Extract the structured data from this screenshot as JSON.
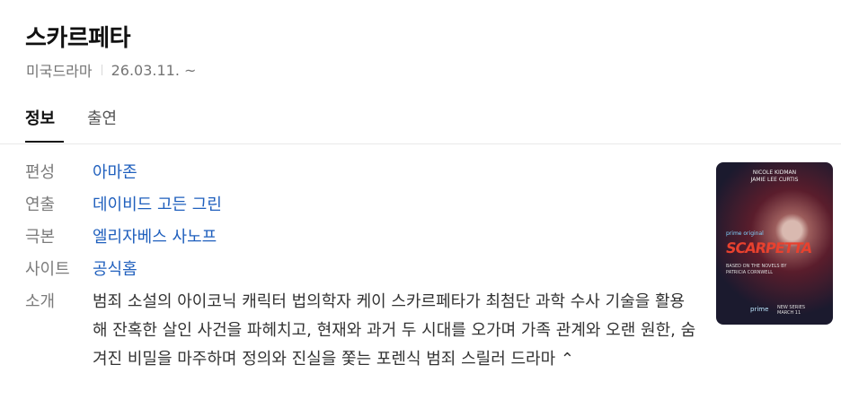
{
  "header": {
    "title": "스카르페타",
    "genre": "미국드라마",
    "date": "26.03.11. ~"
  },
  "tabs": [
    {
      "label": "정보",
      "active": true
    },
    {
      "label": "출연",
      "active": false
    }
  ],
  "info": {
    "rows": [
      {
        "label": "편성",
        "value": "아마존"
      },
      {
        "label": "연출",
        "value": "데이비드 고든 그린"
      },
      {
        "label": "극본",
        "value": "엘리자베스 사노프"
      },
      {
        "label": "사이트",
        "value": "공식홈"
      }
    ],
    "synopsis_label": "소개",
    "synopsis": "범죄 소설의 아이코닉 캐릭터 법의학자 케이 스카르페타가 최첨단 과학 수사 기술을 활용해 잔혹한 살인 사건을 파헤치고, 현재와 과거 두 시대를 오가며 가족 관계와 오랜 원한, 숨겨진 비밀을 마주하며 정의와 진실을 쫓는 포렌식 범죄 스릴러 드라마",
    "collapse_glyph": "⌃"
  },
  "poster": {
    "names": "NICOLE KIDMAN\nJAMIE LEE CURTIS",
    "badge": "prime original",
    "logo": "SCARPETTA",
    "author": "BASED ON THE NOVELS BY\nPATRICIA CORNWELL",
    "prime": "prime",
    "series": "NEW SERIES\nMARCH 11"
  },
  "colors": {
    "link": "#1f5fbd",
    "label": "#7b7b7b"
  }
}
